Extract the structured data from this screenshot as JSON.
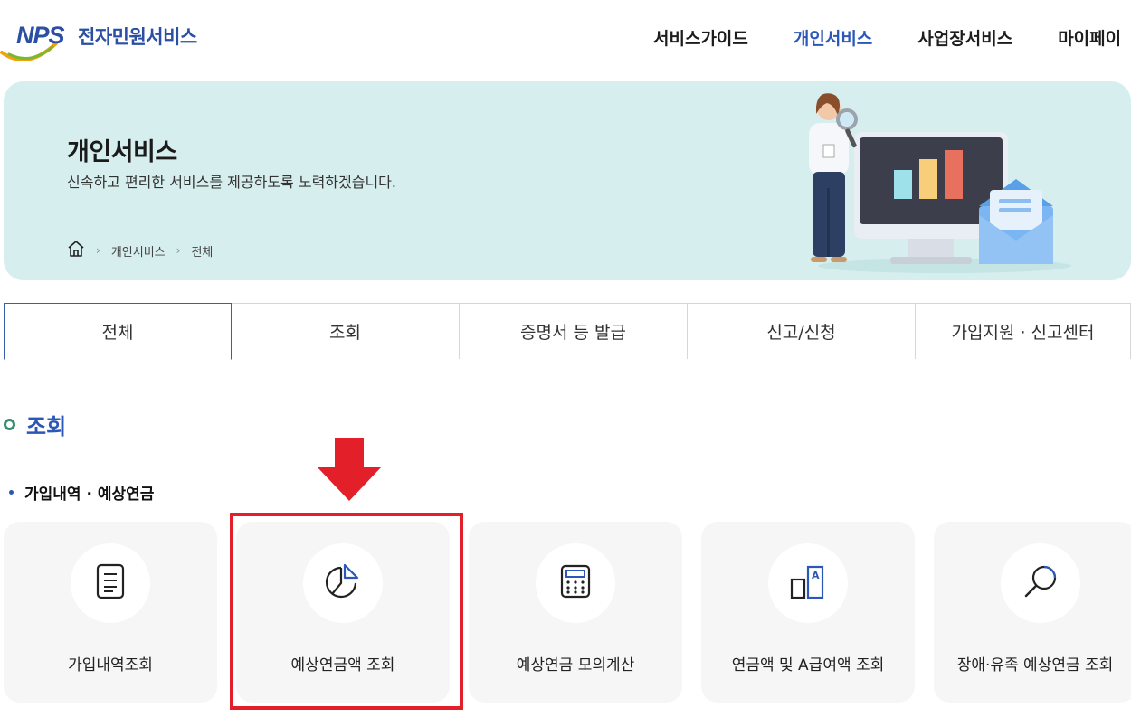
{
  "header": {
    "logo_text": "NPS",
    "logo_service": "전자민원서비스",
    "nav": [
      "서비스가이드",
      "개인서비스",
      "사업장서비스",
      "마이페이"
    ],
    "nav_active_index": 1
  },
  "banner": {
    "title": "개인서비스",
    "subtitle": "신속하고 편리한 서비스를 제공하도록 노력하겠습니다.",
    "breadcrumb": [
      "개인서비스",
      "전체"
    ]
  },
  "tabs": [
    "전체",
    "조회",
    "증명서 등 발급",
    "신고/신청",
    "가입지원 · 신고센터"
  ],
  "tabs_active_index": 0,
  "section": {
    "title": "조회",
    "subsection": "가입내역 · 예상연금",
    "cards": [
      {
        "label": "가입내역조회",
        "icon": "document-icon"
      },
      {
        "label": "예상연금액 조회",
        "icon": "pie-chart-icon"
      },
      {
        "label": "예상연금 모의계산",
        "icon": "calculator-icon"
      },
      {
        "label": "연금액 및 A급여액 조회",
        "icon": "a-chart-icon"
      },
      {
        "label": "장애·유족 예상연금 조회",
        "icon": "magnifier-icon"
      }
    ],
    "highlighted_card_index": 1
  },
  "colors": {
    "brand_blue": "#2b57b8",
    "banner_bg": "#d6eeee",
    "highlight_red": "#e3202a",
    "card_bg": "#f6f6f6"
  }
}
